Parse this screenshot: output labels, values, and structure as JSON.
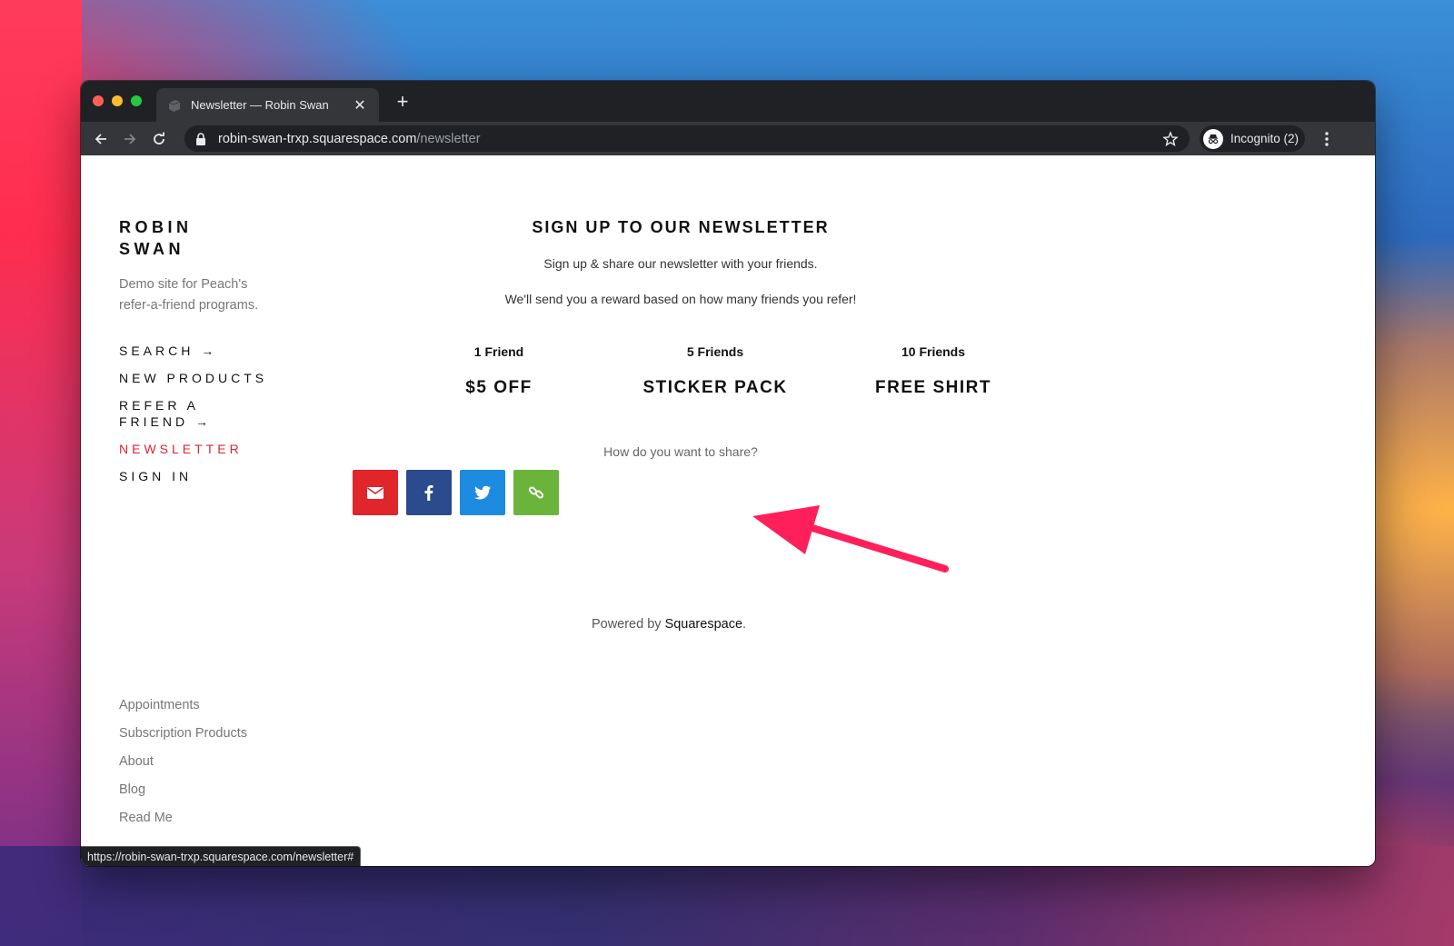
{
  "browser": {
    "tab_title": "Newsletter — Robin Swan",
    "new_tab_symbol": "+",
    "close_symbol": "✕",
    "url_host": "robin-swan-trxp.squarespace.com",
    "url_path": "/newsletter",
    "profile_label": "Incognito (2)",
    "status_url": "https://robin-swan-trxp.squarespace.com/newsletter#"
  },
  "sidebar": {
    "site_title": "ROBIN SWAN",
    "site_description": "Demo site for Peach's refer-a-friend programs.",
    "nav": [
      {
        "label": "SEARCH →"
      },
      {
        "label": "NEW PRODUCTS"
      },
      {
        "label": "REFER A FRIEND →"
      },
      {
        "label": "NEWSLETTER"
      },
      {
        "label": "SIGN IN"
      }
    ],
    "footer_links": [
      {
        "label": "Appointments"
      },
      {
        "label": "Subscription Products"
      },
      {
        "label": "About"
      },
      {
        "label": "Blog"
      },
      {
        "label": "Read Me"
      }
    ]
  },
  "main": {
    "heading": "SIGN UP TO OUR NEWSLETTER",
    "subtitle": "Sign up & share our newsletter with your friends.",
    "subtitle2": "We'll send you a reward based on how many friends you refer!",
    "rewards": [
      {
        "count": "1 Friend",
        "prize": "$5 OFF"
      },
      {
        "count": "5 Friends",
        "prize": "STICKER PACK"
      },
      {
        "count": "10 Friends",
        "prize": "FREE SHIRT"
      }
    ],
    "share_question": "How do you want to share?",
    "share_buttons": [
      "email",
      "facebook",
      "twitter",
      "copy-link"
    ]
  },
  "footer": {
    "powered_prefix": "Powered by ",
    "powered_brand": "Squarespace",
    "powered_suffix": "."
  },
  "colors": {
    "accent_red": "#e0252b",
    "facebook_blue": "#2c4a8e",
    "twitter_blue": "#1d8ce0",
    "link_green": "#6ab43c",
    "annotation_arrow": "#ff1f5a"
  }
}
